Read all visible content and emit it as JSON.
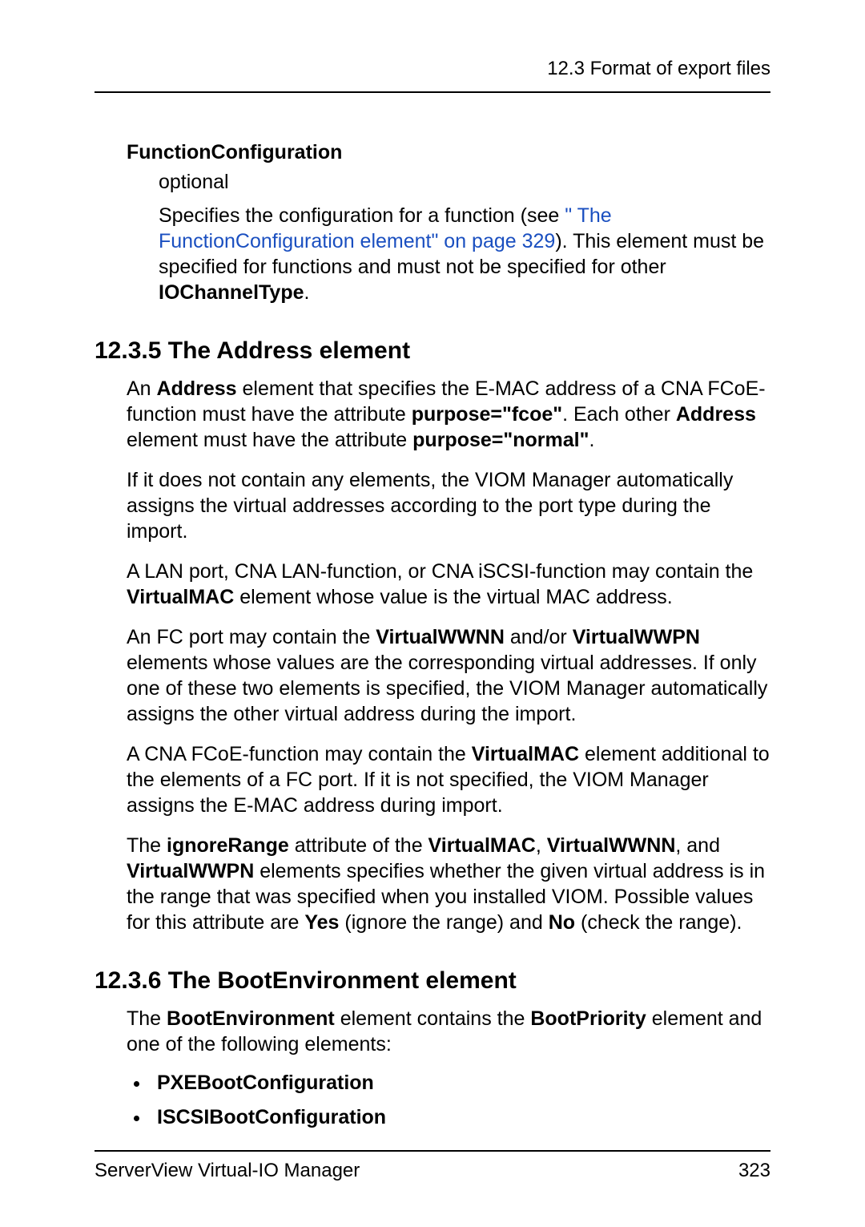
{
  "header": {
    "running_title": "12.3 Format of export files"
  },
  "function_configuration": {
    "title": "FunctionConfiguration",
    "optional": "optional",
    "p_text_before_link": "Specifies the configuration for a function (see ",
    "link_text": "\" The FunctionConfiguration element\" on page 329",
    "p_text_after_link_1": "). This element must be specified for functions and must not be specified for other ",
    "bold_iochanneltype": "IOChannelType",
    "p_text_after_link_2": "."
  },
  "section_1235": {
    "heading": "12.3.5 The Address element",
    "p1_a": "An ",
    "p1_b1": "Address",
    "p1_b": " element that specifies the E-MAC address of a CNA FCoE-function must have the attribute ",
    "p1_b2": "purpose=\"fcoe\"",
    "p1_c": ". Each other ",
    "p1_b3": "Address",
    "p1_d": " element must have the attribute ",
    "p1_b4": "purpose=\"normal\"",
    "p1_e": ".",
    "p2": "If it does not contain any elements, the VIOM Manager automatically assigns the virtual addresses according to the port type during the import.",
    "p3_a": "A LAN port, CNA LAN-function, or CNA iSCSI-function may contain the ",
    "p3_b1": "VirtualMAC",
    "p3_b": " element whose value is the virtual MAC address.",
    "p4_a": "An FC port may contain the ",
    "p4_b1": "VirtualWWNN",
    "p4_b": " and/or ",
    "p4_b2": "VirtualWWPN",
    "p4_c": " elements whose values are the corresponding virtual addresses. If only one of these two elements is specified, the VIOM Manager automatically assigns the other virtual address during the import.",
    "p5_a": "A CNA FCoE-function may contain the ",
    "p5_b1": "VirtualMAC",
    "p5_b": " element additional to the elements of a FC port. If it is not specified, the VIOM Manager assigns the E-MAC address during import.",
    "p6_a": "The ",
    "p6_b1": "ignoreRange",
    "p6_b": " attribute of the ",
    "p6_b2": "VirtualMAC",
    "p6_c": ", ",
    "p6_b3": "VirtualWWNN",
    "p6_d": ", and ",
    "p6_b4": "VirtualWWPN",
    "p6_e": " elements specifies whether the given virtual address is in the range that was specified when you installed VIOM. Possible values for this attribute are ",
    "p6_b5": "Yes",
    "p6_f": " (ignore the range) and ",
    "p6_b6": "No",
    "p6_g": " (check the range)."
  },
  "section_1236": {
    "heading": "12.3.6 The BootEnvironment element",
    "p1_a": "The ",
    "p1_b1": "BootEnvironment",
    "p1_b": " element contains the ",
    "p1_b2": "BootPriority",
    "p1_c": " element and one of the following elements:",
    "bullets": [
      "PXEBootConfiguration",
      "ISCSIBootConfiguration"
    ]
  },
  "footer": {
    "left": "ServerView Virtual-IO Manager",
    "right": "323"
  }
}
